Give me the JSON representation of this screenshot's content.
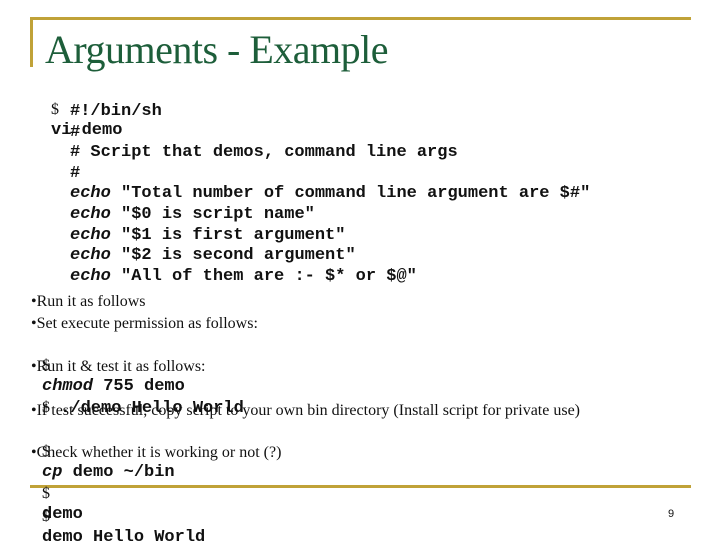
{
  "slide": {
    "title": "Arguments - Example",
    "page_number": "9",
    "accent_color": "#c0a238",
    "title_color": "#1d5e3a"
  },
  "script": {
    "open_prompt": "$",
    "open_command": "vi demo",
    "lines": [
      {
        "keyword": "",
        "text": "#!/bin/sh"
      },
      {
        "keyword": "",
        "text": "#"
      },
      {
        "keyword": "",
        "text": "# Script that demos, command line args"
      },
      {
        "keyword": "",
        "text": "#"
      },
      {
        "keyword": "echo",
        "text": " \"Total number of command line argument are $#\""
      },
      {
        "keyword": "echo",
        "text": " \"$0 is script name\""
      },
      {
        "keyword": "echo",
        "text": " \"$1 is first argument\""
      },
      {
        "keyword": "echo",
        "text": " \"$2 is second argument\""
      },
      {
        "keyword": "echo",
        "text": " \"All of them are :- $* or $@\""
      }
    ]
  },
  "steps": {
    "b1": "•Run it as follows",
    "b2": "•Set execute permission as follows:",
    "c1_prompt": "$",
    "c1_cmd": "chmod",
    "c1_args": " 755 demo",
    "b3": "•Run it & test it as follows:",
    "c2_prompt": "$",
    "c2_cmd": " ./demo Hello World",
    "b4": "•If test successful, copy script to your own bin directory (Install script for private use)",
    "c3_prompt": "$",
    "c3_cmd": "cp",
    "c3_args": " demo ~/bin",
    "b5": "•Check whether it is working or not (?)",
    "c4_prompt": "$",
    "c4_cmd": "demo",
    "c5_prompt": "$",
    "c5_cmd": "demo Hello World"
  }
}
